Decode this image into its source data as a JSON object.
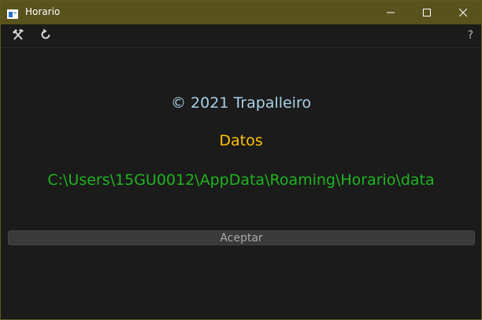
{
  "window": {
    "title": "Horario",
    "accent_color": "#58531d"
  },
  "titlebar_icons": {
    "app": "app-window-icon",
    "minimize": "minimize-icon",
    "maximize": "maximize-icon",
    "close": "close-icon"
  },
  "toolbar": {
    "tools_icon": "hammer-pick-icon",
    "refresh_icon": "refresh-icon",
    "help_label": "?"
  },
  "about": {
    "copyright": "© 2021 Trapalleiro",
    "data_heading": "Datos",
    "data_path": "C:\\Users\\15GU0012\\AppData\\Roaming\\Horario\\data",
    "colors": {
      "copyright": "#a9d0e8",
      "heading": "#ffc107",
      "path": "#1fb51f"
    }
  },
  "actions": {
    "accept_label": "Aceptar"
  }
}
